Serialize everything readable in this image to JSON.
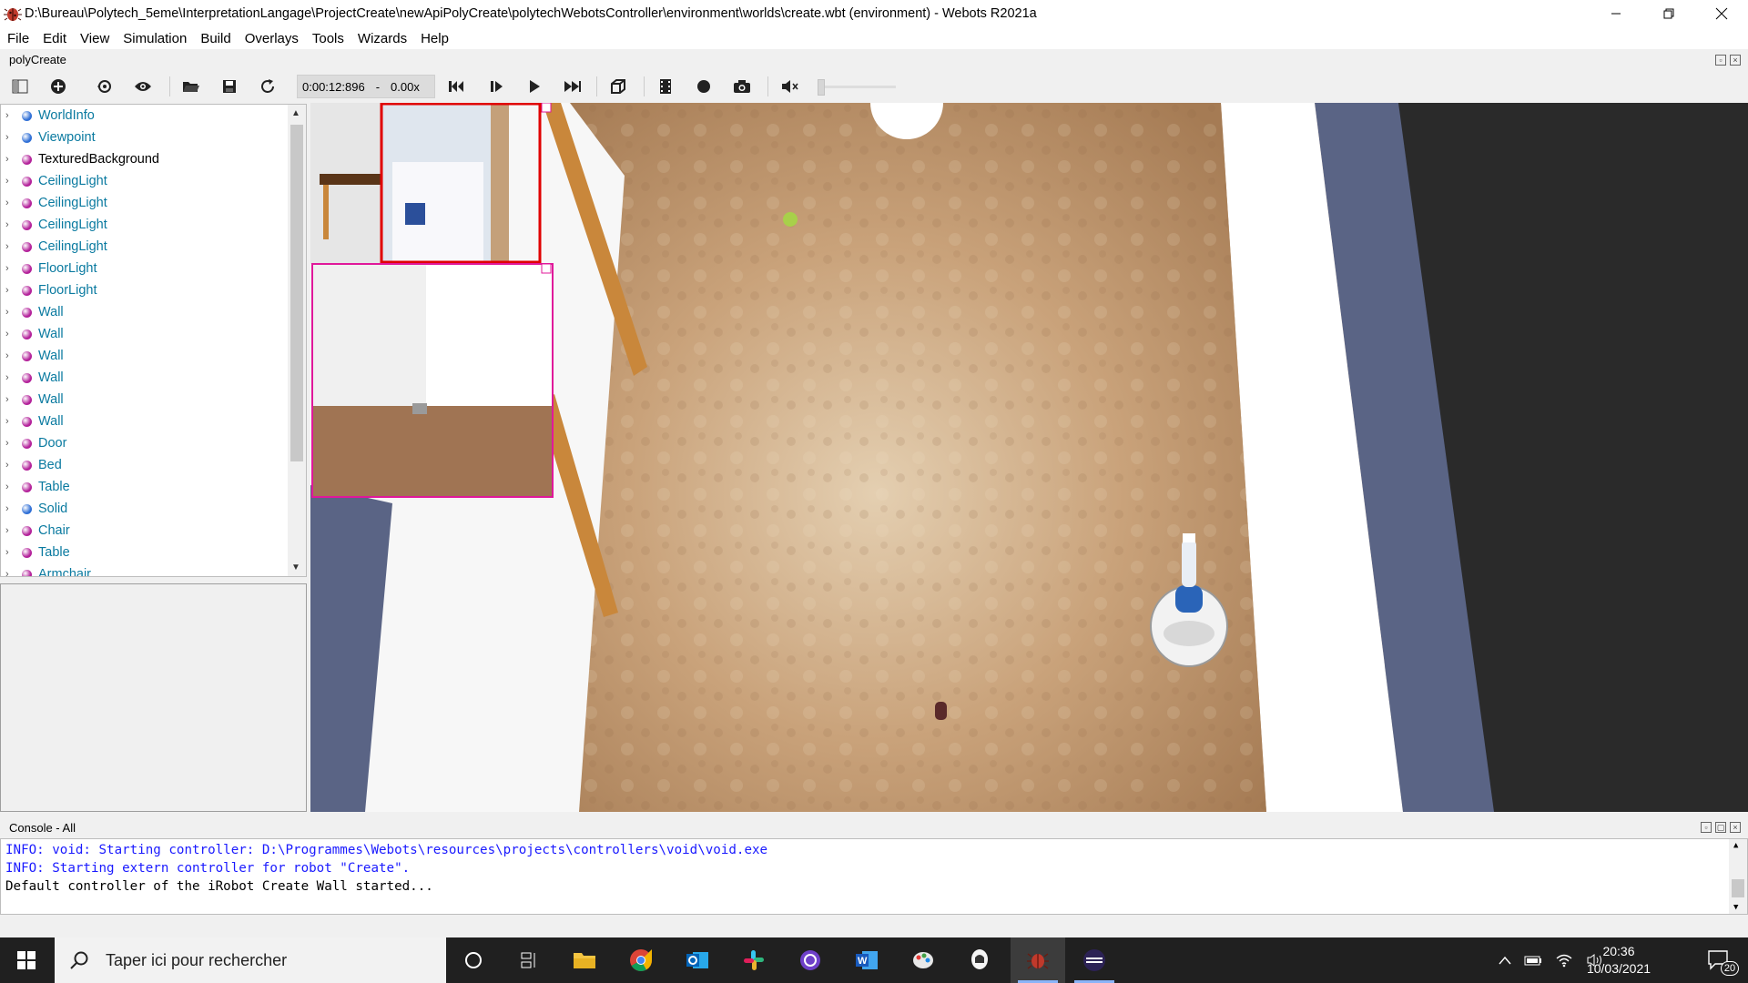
{
  "window": {
    "title": "D:\\Bureau\\Polytech_5eme\\InterpretationLangage\\ProjectCreate\\newApiPolyCreate\\polytechWebotsController\\environment\\worlds\\create.wbt (environment) - Webots R2021a"
  },
  "menu": [
    "File",
    "Edit",
    "View",
    "Simulation",
    "Build",
    "Overlays",
    "Tools",
    "Wizards",
    "Help"
  ],
  "panel_title": "polyCreate",
  "toolbar": {
    "time": "0:00:12:896",
    "dash": "-",
    "speed": "0.00x",
    "volume_level": 0
  },
  "scene_tree": {
    "nodes": [
      {
        "label": "WorldInfo",
        "dot": "#2f6fd6",
        "black": false
      },
      {
        "label": "Viewpoint",
        "dot": "#2f6fd6",
        "black": false
      },
      {
        "label": "TexturedBackground",
        "dot": "#b3219a",
        "black": true
      },
      {
        "label": "CeilingLight",
        "dot": "#b3219a",
        "black": false
      },
      {
        "label": "CeilingLight",
        "dot": "#b3219a",
        "black": false
      },
      {
        "label": "CeilingLight",
        "dot": "#b3219a",
        "black": false
      },
      {
        "label": "CeilingLight",
        "dot": "#b3219a",
        "black": false
      },
      {
        "label": "FloorLight",
        "dot": "#b3219a",
        "black": false
      },
      {
        "label": "FloorLight",
        "dot": "#b3219a",
        "black": false
      },
      {
        "label": "Wall",
        "dot": "#b3219a",
        "black": false
      },
      {
        "label": "Wall",
        "dot": "#b3219a",
        "black": false
      },
      {
        "label": "Wall",
        "dot": "#b3219a",
        "black": false
      },
      {
        "label": "Wall",
        "dot": "#b3219a",
        "black": false
      },
      {
        "label": "Wall",
        "dot": "#b3219a",
        "black": false
      },
      {
        "label": "Wall",
        "dot": "#b3219a",
        "black": false
      },
      {
        "label": "Door",
        "dot": "#b3219a",
        "black": false
      },
      {
        "label": "Bed",
        "dot": "#b3219a",
        "black": false
      },
      {
        "label": "Table",
        "dot": "#b3219a",
        "black": false
      },
      {
        "label": "Solid",
        "dot": "#2f6fd6",
        "black": false
      },
      {
        "label": "Chair",
        "dot": "#b3219a",
        "black": false
      },
      {
        "label": "Table",
        "dot": "#b3219a",
        "black": false
      },
      {
        "label": "Armchair",
        "dot": "#b3219a",
        "black": false
      }
    ]
  },
  "console": {
    "title": "Console - All",
    "lines": [
      {
        "text": "INFO: void: Starting controller: D:\\Programmes\\Webots\\resources\\projects\\controllers\\void\\void.exe",
        "type": "info"
      },
      {
        "text": "INFO: Starting extern controller for robot \"Create\".",
        "type": "info"
      },
      {
        "text": "Default controller of the iRobot Create Wall started...",
        "type": "normal"
      }
    ]
  },
  "taskbar": {
    "search_placeholder": "Taper ici pour rechercher",
    "apps": [
      "cortana-icon",
      "task-view-icon",
      "file-explorer-icon",
      "chrome-icon",
      "outlook-icon",
      "slack-icon",
      "github-desktop-icon",
      "word-icon",
      "paint-icon",
      "app-icon",
      "webots-icon",
      "eclipse-icon"
    ],
    "time": "20:36",
    "date": "10/03/2021",
    "notifications": "20"
  },
  "colors": {
    "accent_magenta": "#e0189a",
    "camera_red": "#e00000",
    "floor": "#c9a27a",
    "wall_blue": "#5a6485",
    "info_text": "#1a1aff"
  }
}
